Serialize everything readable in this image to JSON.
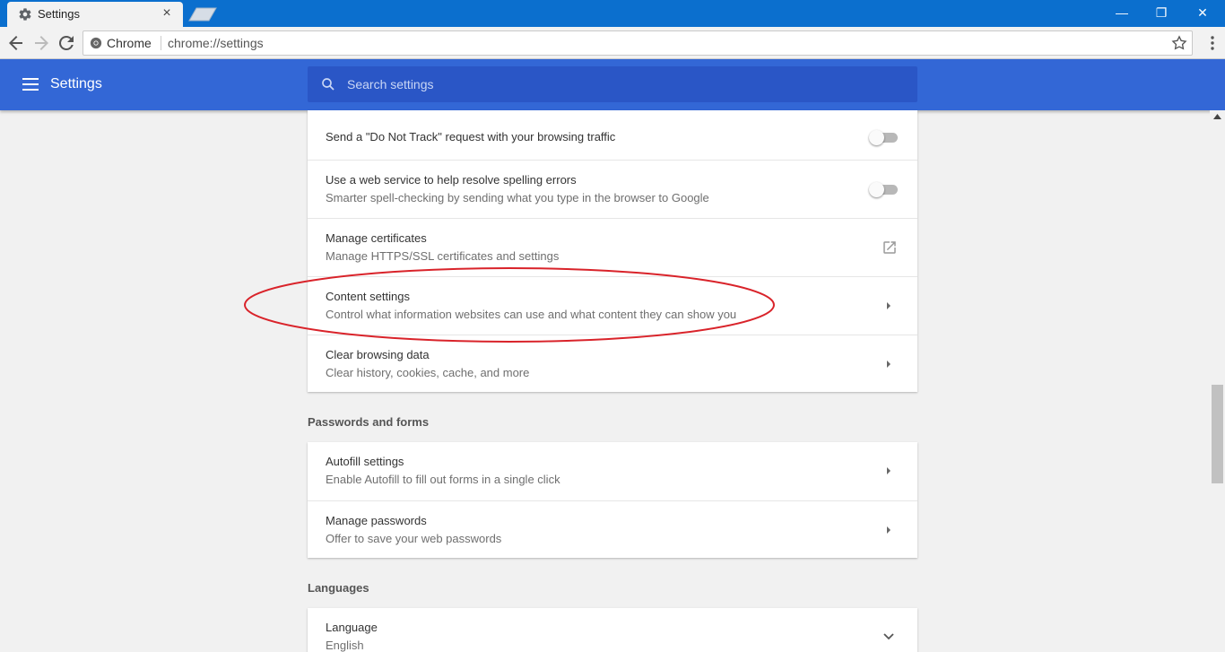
{
  "browser": {
    "tab_title": "Settings",
    "tab_close": "×",
    "omnibox_chip": "Chrome",
    "url": "chrome://settings",
    "window_controls": {
      "minimize": "—",
      "restore": "❐",
      "close": "✕"
    }
  },
  "header": {
    "title": "Settings",
    "search_placeholder": "Search settings"
  },
  "privacy_card": {
    "rows": [
      {
        "title": "Send a \"Do Not Track\" request with your browsing traffic",
        "control": "toggle",
        "enabled": false
      },
      {
        "title": "Use a web service to help resolve spelling errors",
        "subtitle": "Smarter spell-checking by sending what you type in the browser to Google",
        "control": "toggle",
        "enabled": false
      },
      {
        "title": "Manage certificates",
        "subtitle": "Manage HTTPS/SSL certificates and settings",
        "control": "external-link-icon"
      },
      {
        "title": "Content settings",
        "subtitle": "Control what information websites can use and what content they can show you",
        "control": "arrow-right-icon",
        "highlighted": true
      },
      {
        "title": "Clear browsing data",
        "subtitle": "Clear history, cookies, cache, and more",
        "control": "arrow-right-icon"
      }
    ]
  },
  "passwords_section": {
    "title": "Passwords and forms",
    "rows": [
      {
        "title": "Autofill settings",
        "subtitle": "Enable Autofill to fill out forms in a single click",
        "control": "arrow-right-icon"
      },
      {
        "title": "Manage passwords",
        "subtitle": "Offer to save your web passwords",
        "control": "arrow-right-icon"
      }
    ]
  },
  "languages_section": {
    "title": "Languages",
    "rows": [
      {
        "title": "Language",
        "subtitle": "English",
        "control": "chevron-down-icon"
      }
    ]
  },
  "colors": {
    "tab_strip": "#0b6fce",
    "app_bar": "#3367d6",
    "search_box": "#2a56c6",
    "annotation": "#d9232a"
  }
}
